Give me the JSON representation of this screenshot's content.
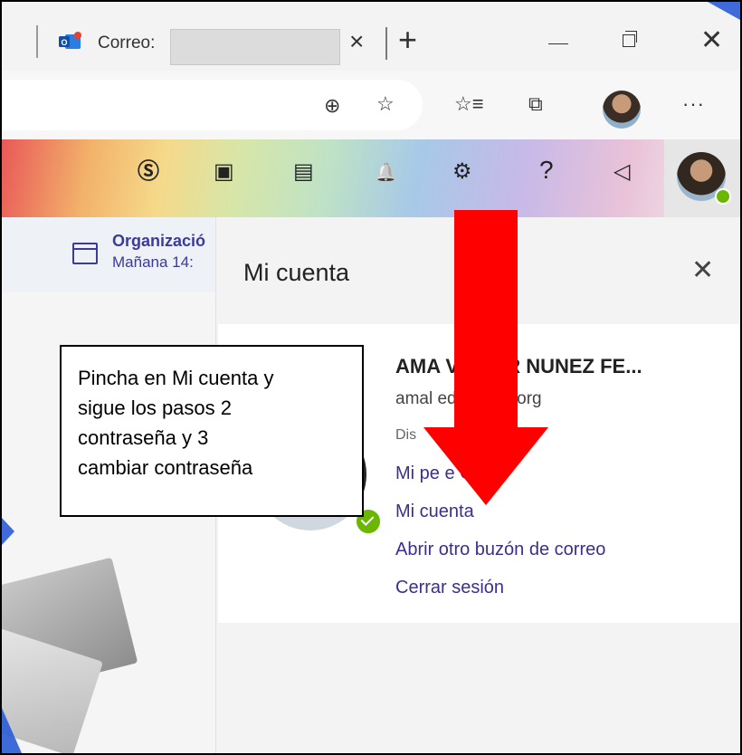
{
  "browser": {
    "tab_title": "Correo: ",
    "tab_close": "×",
    "new_tab": "+",
    "minimize": "—",
    "close": "✕"
  },
  "toolbar": {
    "add_icon": "⊕",
    "favorite_icon": "☆",
    "favorites_icon": "☆≡",
    "collections_icon": "⧉",
    "more_icon": "···"
  },
  "owa_header": {
    "skype_icon": "Ⓢ",
    "teams_icon": "▣",
    "calendar_check_icon": "▤",
    "bell_icon": "🔔",
    "settings_icon": "⚙",
    "help_icon": "?",
    "megaphone_icon": "◁"
  },
  "calendar": {
    "title": "Organizació",
    "time": "Mañana 14:"
  },
  "panel": {
    "title": "Mi cuenta",
    "close": "✕",
    "user_name": "AMA         VICTOR NUNEZ FE...",
    "user_email": "amal           educastur.org",
    "user_status": "Dis",
    "links": [
      "Mi pe           e Office",
      "Mi cuenta",
      "Abrir otro buzón de correo",
      "Cerrar sesión"
    ]
  },
  "annotation": {
    "lines": [
      "Pincha en Mi cuenta y",
      "sigue los pasos 2",
      "contraseña y 3",
      "cambiar contraseña"
    ],
    "arrow_color": "#ff0000"
  },
  "colors": {
    "link": "#3b2f8e",
    "presence": "#6bb700",
    "accent_blue": "#2a5bd7"
  }
}
